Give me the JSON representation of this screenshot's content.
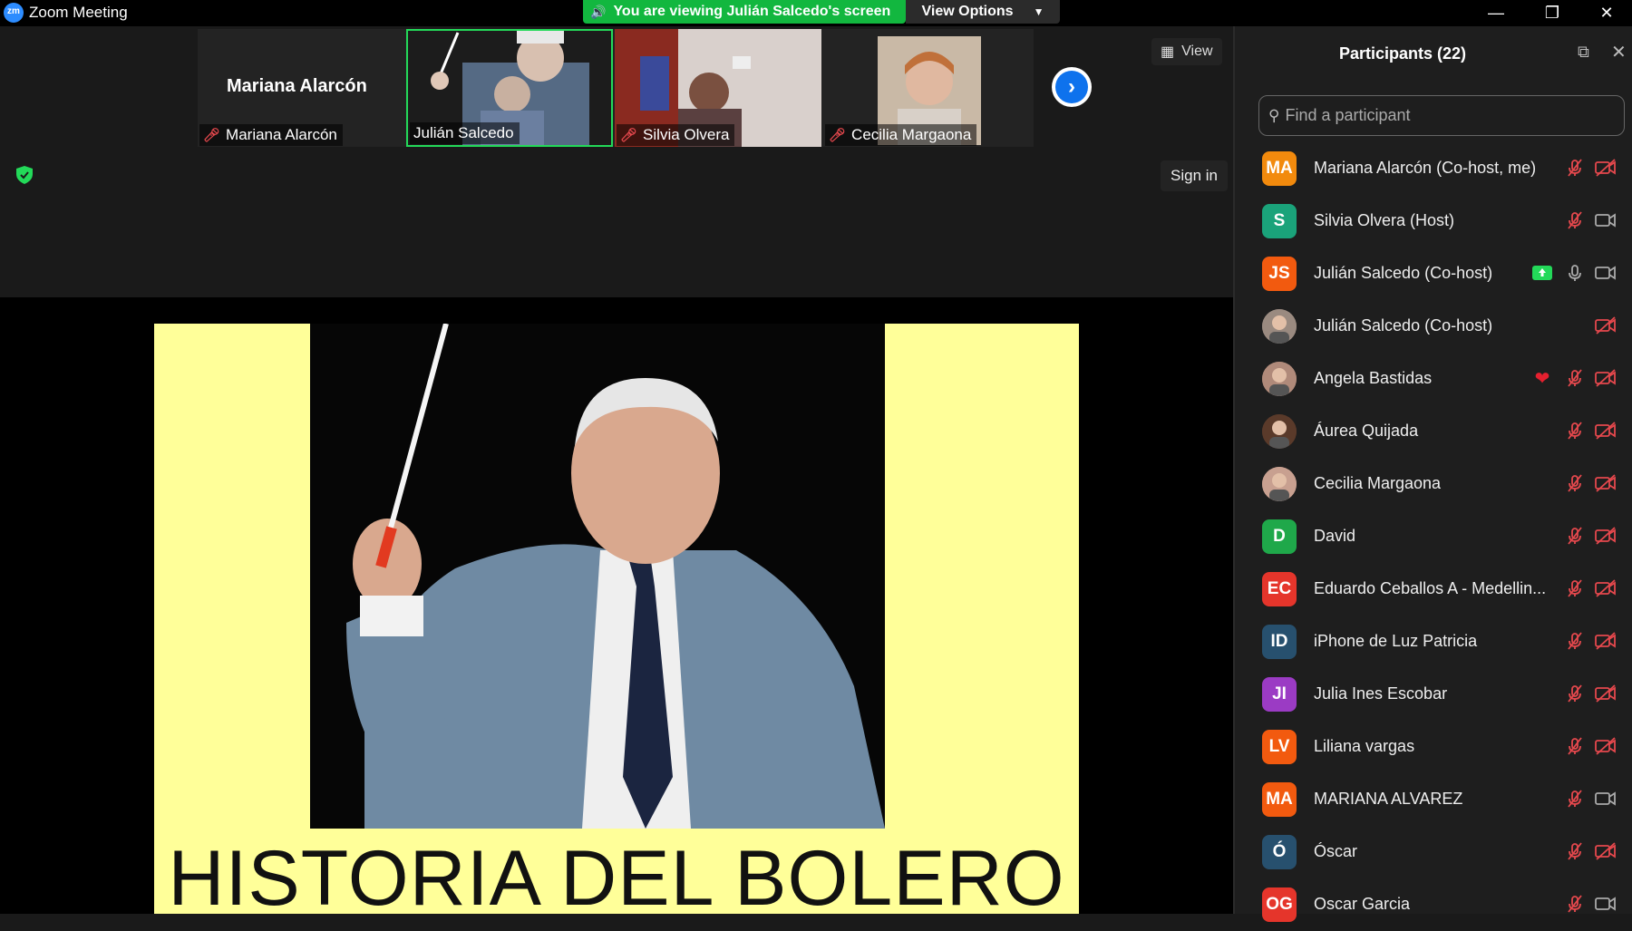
{
  "window": {
    "title": "Zoom Meeting",
    "app_icon": "zm",
    "share_banner": "You are viewing Julián Salcedo's screen",
    "view_options": "View Options"
  },
  "stage": {
    "active_speaker_name": "Mariana Alarcón",
    "tiles": [
      {
        "name": "Mariana Alarcón",
        "muted": true
      },
      {
        "name": "Julián Salcedo",
        "muted": false,
        "active": true
      },
      {
        "name": "Silvia Olvera",
        "muted": true
      },
      {
        "name": "Cecilia Margaona",
        "muted": true
      }
    ],
    "view_button": "View",
    "sign_in": "Sign in"
  },
  "slide": {
    "title": "HISTORIA DEL BOLERO"
  },
  "participants": {
    "title": "Participants (22)",
    "search_placeholder": "Find a participant",
    "items": [
      {
        "initials": "MA",
        "name": "Mariana Alarcón (Co-host, me)",
        "color": "#f28a0d",
        "mic": "muted",
        "cam": "off"
      },
      {
        "initials": "S",
        "name": "Silvia Olvera (Host)",
        "color": "#1aa37a",
        "mic": "muted",
        "cam": "on"
      },
      {
        "initials": "JS",
        "name": "Julián Salcedo (Co-host)",
        "color": "#f25a0f",
        "mic": "on",
        "cam": "on",
        "sharing": true
      },
      {
        "initials": "",
        "name": "Julián Salcedo (Co-host)",
        "color": "#9a8a80",
        "mic": "none",
        "cam": "off",
        "photo": true
      },
      {
        "initials": "",
        "name": "Angela Bastidas",
        "color": "#b08a7a",
        "mic": "muted",
        "cam": "off",
        "photo": true,
        "reaction": "heart"
      },
      {
        "initials": "",
        "name": "Áurea Quijada",
        "color": "#5a3a2a",
        "mic": "muted",
        "cam": "off",
        "photo": true
      },
      {
        "initials": "",
        "name": "Cecilia Margaona",
        "color": "#c8a090",
        "mic": "muted",
        "cam": "off",
        "photo": true
      },
      {
        "initials": "D",
        "name": "David",
        "color": "#1fa84a",
        "mic": "muted",
        "cam": "off"
      },
      {
        "initials": "EC",
        "name": "Eduardo Ceballos A - Medellin...",
        "color": "#e5352b",
        "mic": "muted",
        "cam": "off"
      },
      {
        "initials": "ID",
        "name": "iPhone de Luz Patricia",
        "color": "#27506e",
        "mic": "muted",
        "cam": "off"
      },
      {
        "initials": "JI",
        "name": "Julia Ines Escobar",
        "color": "#9b3bc4",
        "mic": "muted",
        "cam": "off"
      },
      {
        "initials": "LV",
        "name": "Liliana vargas",
        "color": "#f25a0f",
        "mic": "muted",
        "cam": "off"
      },
      {
        "initials": "MA",
        "name": "MARIANA ALVAREZ",
        "color": "#f25a0f",
        "mic": "muted",
        "cam": "on"
      },
      {
        "initials": "Ó",
        "name": "Óscar",
        "color": "#27506e",
        "mic": "muted",
        "cam": "off"
      },
      {
        "initials": "OG",
        "name": "Oscar Garcia",
        "color": "#e5352b",
        "mic": "muted",
        "cam": "on"
      }
    ]
  },
  "colors": {
    "accent_green": "#23d959",
    "banner_green": "#12b73f",
    "muted_red": "#e5484d",
    "slide_yellow": "#ffff99",
    "zoom_blue": "#0e72ed"
  }
}
